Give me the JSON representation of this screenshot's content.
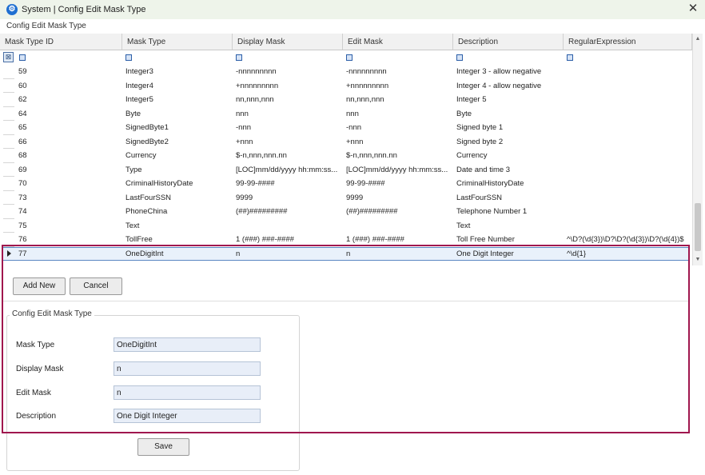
{
  "window": {
    "title": "System | Config Edit Mask Type",
    "close_label": "✕",
    "app_icon_glyph": "⚙"
  },
  "grid": {
    "section_label": "Config Edit Mask Type",
    "columns": [
      "Mask Type ID",
      "Mask Type",
      "Display Mask",
      "Edit Mask",
      "Description",
      "RegularExpression"
    ],
    "rows": [
      [
        "59",
        "Integer3",
        "-nnnnnnnnn",
        "-nnnnnnnnn",
        "Integer 3 - allow negative",
        ""
      ],
      [
        "60",
        "Integer4",
        "+nnnnnnnnn",
        "+nnnnnnnnn",
        "Integer 4 - allow negative",
        ""
      ],
      [
        "62",
        "Integer5",
        "nn,nnn,nnn",
        "nn,nnn,nnn",
        "Integer 5",
        ""
      ],
      [
        "64",
        "Byte",
        "nnn",
        "nnn",
        "Byte",
        ""
      ],
      [
        "65",
        "SignedByte1",
        "-nnn",
        "-nnn",
        "Signed byte 1",
        ""
      ],
      [
        "66",
        "SignedByte2",
        "+nnn",
        "+nnn",
        "Signed byte 2",
        ""
      ],
      [
        "68",
        "Currency",
        "$-n,nnn,nnn.nn",
        "$-n,nnn,nnn.nn",
        "Currency",
        ""
      ],
      [
        "69",
        "Type",
        "[LOC]mm/dd/yyyy  hh:mm:ss...",
        "[LOC]mm/dd/yyyy  hh:mm:ss...",
        "Date and time 3",
        ""
      ],
      [
        "70",
        "CriminalHistoryDate",
        "99-99-####",
        "99-99-####",
        "CriminalHistoryDate",
        ""
      ],
      [
        "73",
        "LastFourSSN",
        "9999",
        "9999",
        "LastFourSSN",
        ""
      ],
      [
        "74",
        "PhoneChina",
        "(##)#########",
        "(##)#########",
        "Telephone Number 1",
        ""
      ],
      [
        "75",
        "Text",
        "",
        "",
        "Text",
        ""
      ],
      [
        "76",
        "TollFree",
        "1 (###) ###-####",
        "1 (###) ###-####",
        "Toll Free Number",
        "^\\D?(\\d{3})\\D?\\D?(\\d{3})\\D?(\\d{4})$"
      ]
    ],
    "selected_row": [
      "77",
      "OneDigitInt",
      "n",
      "n",
      "One Digit Integer",
      "^\\d{1}"
    ]
  },
  "actions": {
    "add_new_label": "Add New",
    "cancel_label": "Cancel"
  },
  "form": {
    "group_title": "Config Edit Mask Type",
    "mask_type_label": "Mask Type",
    "mask_type_value": "OneDigitInt",
    "display_mask_label": "Display Mask",
    "display_mask_value": "n",
    "edit_mask_label": "Edit Mask",
    "edit_mask_value": "n",
    "description_label": "Description",
    "description_value": "One Digit Integer",
    "save_label": "Save"
  },
  "colors": {
    "highlight": "#a0174e",
    "title_bar": "#eef4ea",
    "selection": "#e9f1fb"
  }
}
